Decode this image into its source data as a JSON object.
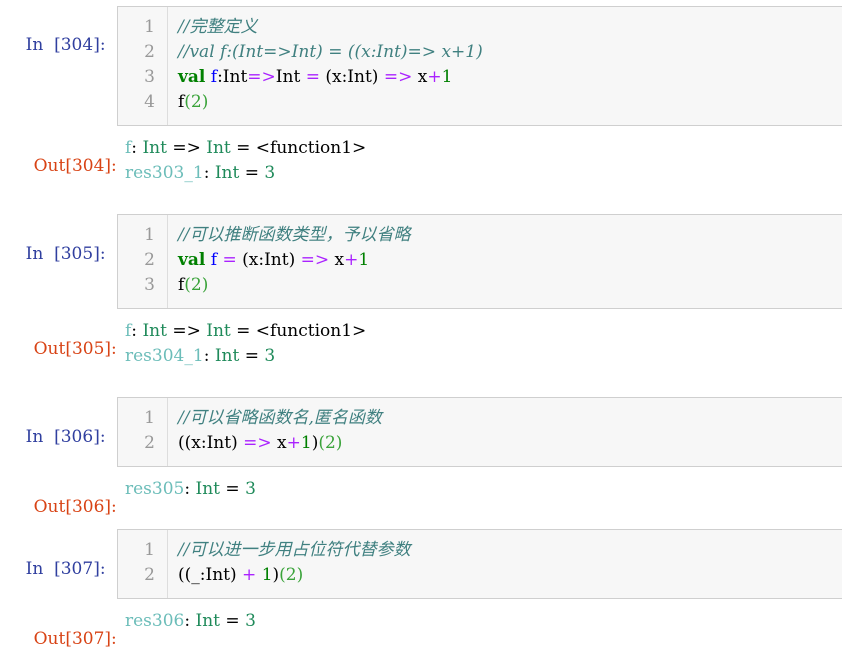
{
  "cells": [
    {
      "in_label": "In",
      "exec_count": "[304]:",
      "code_lines": [
        {
          "n": "1",
          "tokens": [
            {
              "t": "//完整定义",
              "c": "cm"
            }
          ]
        },
        {
          "n": "2",
          "tokens": [
            {
              "t": "//val f:(Int=>Int) = ((x:Int)=> x+1)",
              "c": "cm"
            }
          ]
        },
        {
          "n": "3",
          "tokens": [
            {
              "t": "val",
              "c": "kw"
            },
            {
              "t": " ",
              "c": ""
            },
            {
              "t": "f",
              "c": "def"
            },
            {
              "t": ":Int",
              "c": ""
            },
            {
              "t": "=>",
              "c": "op"
            },
            {
              "t": "Int ",
              "c": ""
            },
            {
              "t": "=",
              "c": "op"
            },
            {
              "t": " (x:Int) ",
              "c": ""
            },
            {
              "t": "=>",
              "c": "op"
            },
            {
              "t": " x",
              "c": ""
            },
            {
              "t": "+",
              "c": "op"
            },
            {
              "t": "1",
              "c": "num-lit"
            }
          ]
        },
        {
          "n": "4",
          "tokens": [
            {
              "t": "f",
              "c": ""
            },
            {
              "t": "(2)",
              "c": "paren-g"
            }
          ]
        }
      ],
      "out_label": "Out",
      "out_count": "[304]:",
      "output_lines": [
        [
          {
            "t": "f",
            "c": "o-name"
          },
          {
            "t": ": ",
            "c": "o-plain"
          },
          {
            "t": "Int",
            "c": "o-type"
          },
          {
            "t": " => ",
            "c": "o-plain"
          },
          {
            "t": "Int",
            "c": "o-type"
          },
          {
            "t": " = <function1>",
            "c": "o-plain"
          }
        ],
        [
          {
            "t": "res303_1",
            "c": "o-name"
          },
          {
            "t": ": ",
            "c": "o-plain"
          },
          {
            "t": "Int",
            "c": "o-type"
          },
          {
            "t": " = ",
            "c": "o-plain"
          },
          {
            "t": "3",
            "c": "o-type"
          }
        ]
      ]
    },
    {
      "in_label": "In",
      "exec_count": "[305]:",
      "code_lines": [
        {
          "n": "1",
          "tokens": [
            {
              "t": "//可以推断函数类型，予以省略",
              "c": "cm"
            }
          ]
        },
        {
          "n": "2",
          "tokens": [
            {
              "t": "val",
              "c": "kw"
            },
            {
              "t": " ",
              "c": ""
            },
            {
              "t": "f",
              "c": "def"
            },
            {
              "t": " ",
              "c": ""
            },
            {
              "t": "=",
              "c": "op"
            },
            {
              "t": " (x:Int) ",
              "c": ""
            },
            {
              "t": "=>",
              "c": "op"
            },
            {
              "t": " x",
              "c": ""
            },
            {
              "t": "+",
              "c": "op"
            },
            {
              "t": "1",
              "c": "num-lit"
            }
          ]
        },
        {
          "n": "3",
          "tokens": [
            {
              "t": "f",
              "c": ""
            },
            {
              "t": "(2)",
              "c": "paren-g"
            }
          ]
        }
      ],
      "out_label": "Out",
      "out_count": "[305]:",
      "output_lines": [
        [
          {
            "t": "f",
            "c": "o-name"
          },
          {
            "t": ": ",
            "c": "o-plain"
          },
          {
            "t": "Int",
            "c": "o-type"
          },
          {
            "t": " => ",
            "c": "o-plain"
          },
          {
            "t": "Int",
            "c": "o-type"
          },
          {
            "t": " = <function1>",
            "c": "o-plain"
          }
        ],
        [
          {
            "t": "res304_1",
            "c": "o-name"
          },
          {
            "t": ": ",
            "c": "o-plain"
          },
          {
            "t": "Int",
            "c": "o-type"
          },
          {
            "t": " = ",
            "c": "o-plain"
          },
          {
            "t": "3",
            "c": "o-type"
          }
        ]
      ]
    },
    {
      "in_label": "In",
      "exec_count": "[306]:",
      "code_lines": [
        {
          "n": "1",
          "tokens": [
            {
              "t": "//可以省略函数名,匿名函数",
              "c": "cm"
            }
          ]
        },
        {
          "n": "2",
          "tokens": [
            {
              "t": "((x:Int) ",
              "c": ""
            },
            {
              "t": "=>",
              "c": "op"
            },
            {
              "t": " x",
              "c": ""
            },
            {
              "t": "+",
              "c": "op"
            },
            {
              "t": "1",
              "c": "num-lit"
            },
            {
              "t": ")",
              "c": ""
            },
            {
              "t": "(2)",
              "c": "paren-g"
            }
          ]
        }
      ],
      "out_label": "Out",
      "out_count": "[306]:",
      "output_lines": [
        [
          {
            "t": "res305",
            "c": "o-name"
          },
          {
            "t": ": ",
            "c": "o-plain"
          },
          {
            "t": "Int",
            "c": "o-type"
          },
          {
            "t": " = ",
            "c": "o-plain"
          },
          {
            "t": "3",
            "c": "o-type"
          }
        ]
      ]
    },
    {
      "in_label": "In",
      "exec_count": "[307]:",
      "code_lines": [
        {
          "n": "1",
          "tokens": [
            {
              "t": "//可以进一步用占位符代替参数",
              "c": "cm"
            }
          ]
        },
        {
          "n": "2",
          "tokens": [
            {
              "t": "((_:Int) ",
              "c": ""
            },
            {
              "t": "+",
              "c": "op"
            },
            {
              "t": " ",
              "c": ""
            },
            {
              "t": "1",
              "c": "num-lit"
            },
            {
              "t": ")",
              "c": ""
            },
            {
              "t": "(2)",
              "c": "paren-g"
            }
          ]
        }
      ],
      "out_label": "Out",
      "out_count": "[307]:",
      "output_lines": [
        [
          {
            "t": "res306",
            "c": "o-name"
          },
          {
            "t": ": ",
            "c": "o-plain"
          },
          {
            "t": "Int",
            "c": "o-type"
          },
          {
            "t": " = ",
            "c": "o-plain"
          },
          {
            "t": "3",
            "c": "o-type"
          }
        ]
      ]
    }
  ]
}
